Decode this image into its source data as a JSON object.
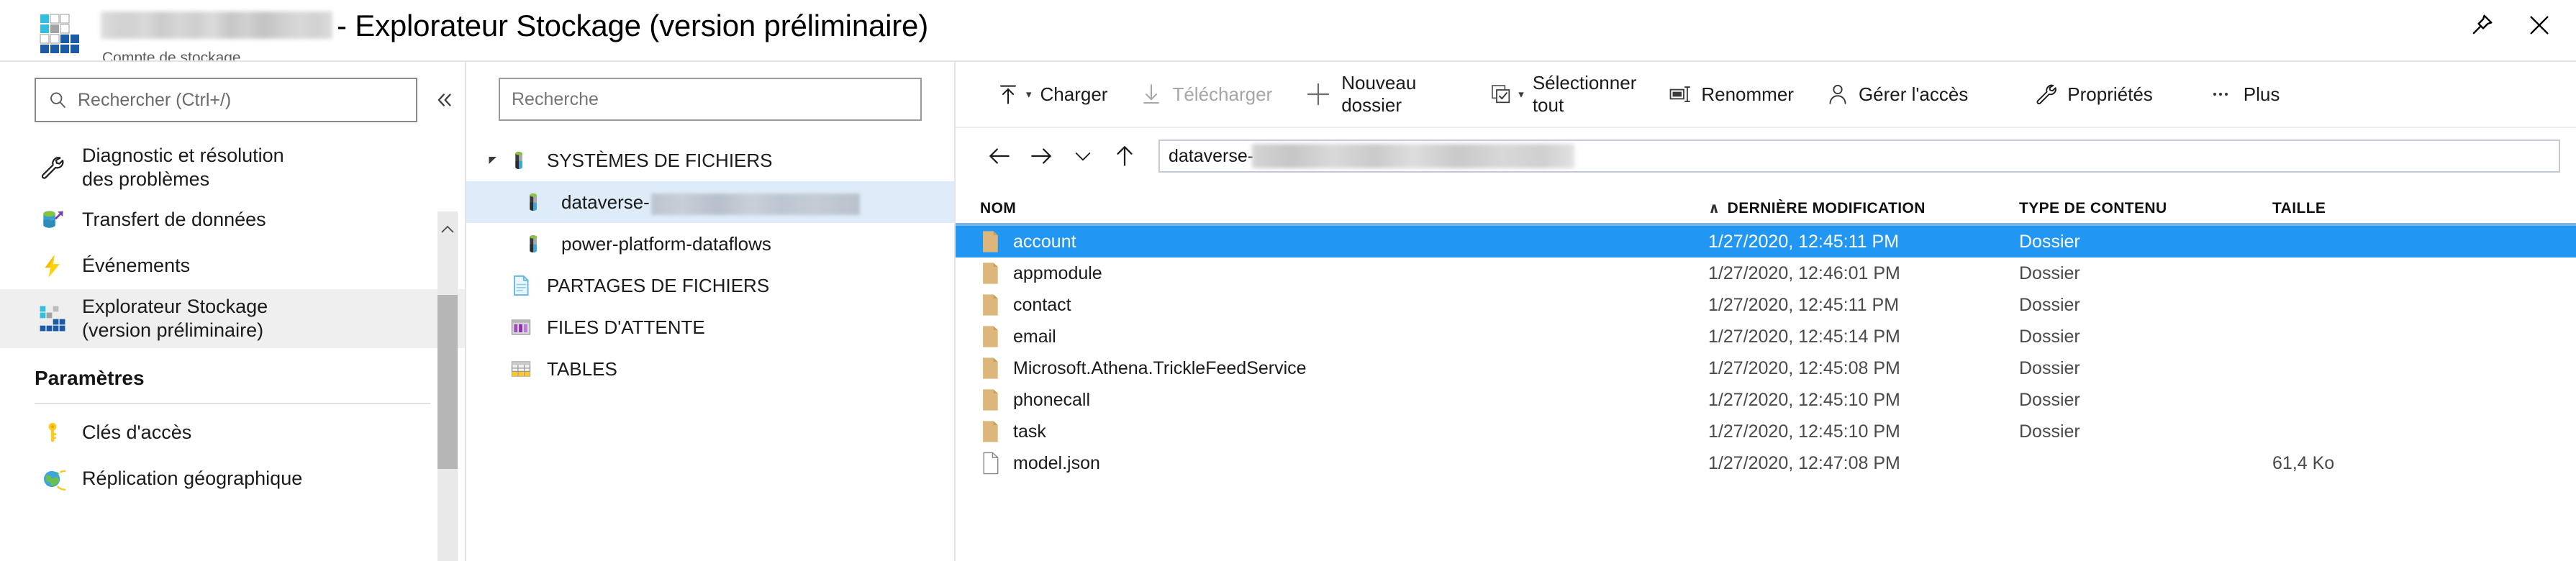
{
  "header": {
    "account_name_redacted": true,
    "title_suffix": "- Explorateur Stockage (version préliminaire)",
    "subtitle": "Compte de stockage",
    "pin_label": "Épingler",
    "close_label": "Fermer"
  },
  "sidebar": {
    "search": {
      "placeholder": "Rechercher (Ctrl+/)",
      "value": ""
    },
    "collapse_label": "«",
    "items": [
      {
        "label": "Diagnostic et résolution\ndes problèmes",
        "icon": "wrench-icon",
        "active": false
      },
      {
        "label": "Transfert de données",
        "icon": "data-transfer-icon",
        "active": false
      },
      {
        "label": "Événements",
        "icon": "lightning-icon",
        "active": false
      },
      {
        "label": "Explorateur Stockage\n(version préliminaire)",
        "icon": "storage-explorer-icon",
        "active": true
      }
    ],
    "section_title": "Paramètres",
    "settings_items": [
      {
        "label": "Clés d'accès",
        "icon": "key-icon"
      },
      {
        "label": "Réplication géographique",
        "icon": "globe-icon"
      }
    ]
  },
  "tree": {
    "search": {
      "placeholder": "Recherche",
      "value": ""
    },
    "nodes": [
      {
        "label": "SYSTÈMES DE FICHIERS",
        "icon": "container-icon",
        "expanded": true,
        "level": 0,
        "selected": false,
        "redacted": false
      },
      {
        "label": "dataverse-",
        "icon": "container-icon",
        "level": 1,
        "selected": true,
        "redacted": true
      },
      {
        "label": "power-platform-dataflows",
        "icon": "container-icon",
        "level": 1,
        "selected": false,
        "redacted": false
      },
      {
        "label": "PARTAGES DE FICHIERS",
        "icon": "file-share-icon",
        "level": 0,
        "selected": false,
        "redacted": false
      },
      {
        "label": "FILES D'ATTENTE",
        "icon": "queue-icon",
        "level": 0,
        "selected": false,
        "redacted": false
      },
      {
        "label": "TABLES",
        "icon": "table-icon",
        "level": 0,
        "selected": false,
        "redacted": false
      }
    ]
  },
  "toolbar": {
    "buttons": [
      {
        "label": "Charger",
        "icon": "upload-icon",
        "caret": true,
        "disabled": false
      },
      {
        "label": "Télécharger",
        "icon": "download-icon",
        "caret": false,
        "disabled": true
      },
      {
        "label": "Nouveau\ndossier",
        "icon": "plus-icon",
        "caret": false,
        "disabled": false
      },
      {
        "label": "Sélectionner\ntout",
        "icon": "select-all-icon",
        "caret": true,
        "disabled": false
      },
      {
        "label": "Renommer",
        "icon": "rename-icon",
        "caret": false,
        "disabled": false
      },
      {
        "label": "Gérer l'accès",
        "icon": "person-icon",
        "caret": false,
        "disabled": false
      },
      {
        "label": "Propriétés",
        "icon": "wrench-icon",
        "caret": false,
        "disabled": false
      },
      {
        "label": "Plus",
        "icon": "ellipsis-icon",
        "caret": false,
        "disabled": false
      }
    ]
  },
  "addressbar": {
    "back_label": "Précédent",
    "forward_label": "Suivant",
    "history_label": "Historique",
    "up_label": "Monter d'un niveau",
    "path_text": "dataverse-",
    "path_redacted": true
  },
  "table": {
    "columns": [
      {
        "key": "name",
        "label": "NOM",
        "sorted": false
      },
      {
        "key": "modified",
        "label": "DERNIÈRE MODIFICATION",
        "sorted": true,
        "sort_dir": "asc"
      },
      {
        "key": "type",
        "label": "TYPE DE CONTENU",
        "sorted": false
      },
      {
        "key": "size",
        "label": "TAILLE",
        "sorted": false
      }
    ],
    "sort_indicator": "∧",
    "rows": [
      {
        "name": "account",
        "modified": "1/27/2020, 12:45:11 PM",
        "type": "Dossier",
        "size": "",
        "icon": "folder-icon",
        "selected": true
      },
      {
        "name": "appmodule",
        "modified": "1/27/2020, 12:46:01 PM",
        "type": "Dossier",
        "size": "",
        "icon": "folder-icon",
        "selected": false
      },
      {
        "name": "contact",
        "modified": "1/27/2020, 12:45:11 PM",
        "type": "Dossier",
        "size": "",
        "icon": "folder-icon",
        "selected": false
      },
      {
        "name": "email",
        "modified": "1/27/2020, 12:45:14 PM",
        "type": "Dossier",
        "size": "",
        "icon": "folder-icon",
        "selected": false
      },
      {
        "name": "Microsoft.Athena.TrickleFeedService",
        "modified": "1/27/2020, 12:45:08 PM",
        "type": "Dossier",
        "size": "",
        "icon": "folder-icon",
        "selected": false
      },
      {
        "name": "phonecall",
        "modified": "1/27/2020, 12:45:10 PM",
        "type": "Dossier",
        "size": "",
        "icon": "folder-icon",
        "selected": false
      },
      {
        "name": "task",
        "modified": "1/27/2020, 12:45:10 PM",
        "type": "Dossier",
        "size": "",
        "icon": "folder-icon",
        "selected": false
      },
      {
        "name": "model.json",
        "modified": "1/27/2020, 12:47:08 PM",
        "type": "",
        "size": "61,4 Ko",
        "icon": "file-icon",
        "selected": false
      }
    ]
  },
  "colors": {
    "selection_blue": "#2196f3",
    "tree_selection": "#deecf9",
    "header_underline": "#7bb4e3",
    "folder": "#dcb67a",
    "accent_cyan": "#32bedd",
    "accent_blue": "#1b5aa4"
  }
}
